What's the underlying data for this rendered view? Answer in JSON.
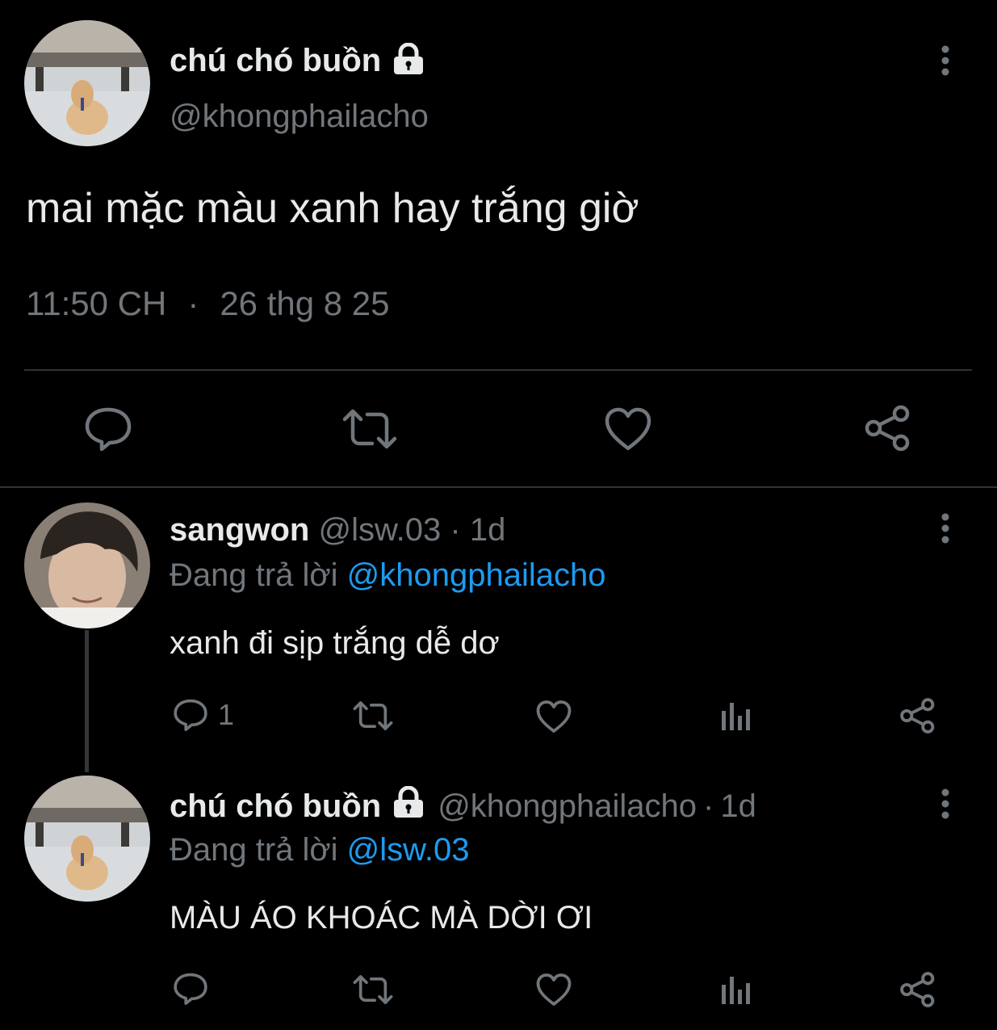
{
  "main_tweet": {
    "display_name": "chú chó buồn",
    "handle": "@khongphailacho",
    "text": "mai mặc màu xanh hay trắng giờ",
    "time": "11:50 CH",
    "separator": "·",
    "date": "26 thg 8 25"
  },
  "reply_1": {
    "display_name": "sangwon",
    "handle": "@lsw.03",
    "meta_sep": "·",
    "age": "1d",
    "replying_prefix": "Đang trả lời",
    "replying_to": "@khongphailacho",
    "text": "xanh đi sịp trắng dễ dơ",
    "reply_count": "1"
  },
  "reply_2": {
    "display_name": "chú chó buồn",
    "handle": "@khongphailacho",
    "meta_sep": "·",
    "age": "1d",
    "replying_prefix": "Đang trả lời",
    "replying_to": "@lsw.03",
    "text": "MÀU ÁO KHOÁC MÀ DỜI ƠI"
  },
  "icons": [
    "more-icon",
    "lock-icon",
    "reply-icon",
    "retweet-icon",
    "like-icon",
    "share-icon",
    "views-icon"
  ],
  "colors": {
    "background": "#000000",
    "text": "#e7e9ea",
    "muted": "#71767b",
    "link": "#1d9bf0",
    "divider": "#2f3336"
  }
}
